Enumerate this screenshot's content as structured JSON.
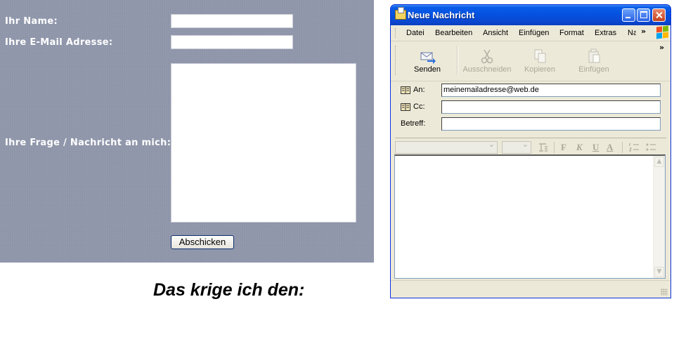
{
  "web_form": {
    "name_label": "Ihr Name:",
    "email_label": "Ihre E-Mail Adresse:",
    "message_label": "Ihre Frage / Nachricht an mich:",
    "submit_label": "Abschicken",
    "background_color": "#8f96aa"
  },
  "caption": "Das krige ich den:",
  "mail_window": {
    "title": "Neue Nachricht",
    "menu": [
      "Datei",
      "Bearbeiten",
      "Ansicht",
      "Einfügen",
      "Format",
      "Extras",
      "Na"
    ],
    "toolbar": {
      "send": "Senden",
      "cut": "Ausschneiden",
      "copy": "Kopieren",
      "paste": "Einfügen"
    },
    "headers": {
      "to_label": "An:",
      "to_value": "meinemailadresse@web.de",
      "cc_label": "Cc:",
      "cc_value": "",
      "subject_label": "Betreff:",
      "subject_value": ""
    },
    "format_buttons": [
      "F",
      "K",
      "U",
      "A"
    ],
    "titlebar_color": "#0453e0"
  }
}
